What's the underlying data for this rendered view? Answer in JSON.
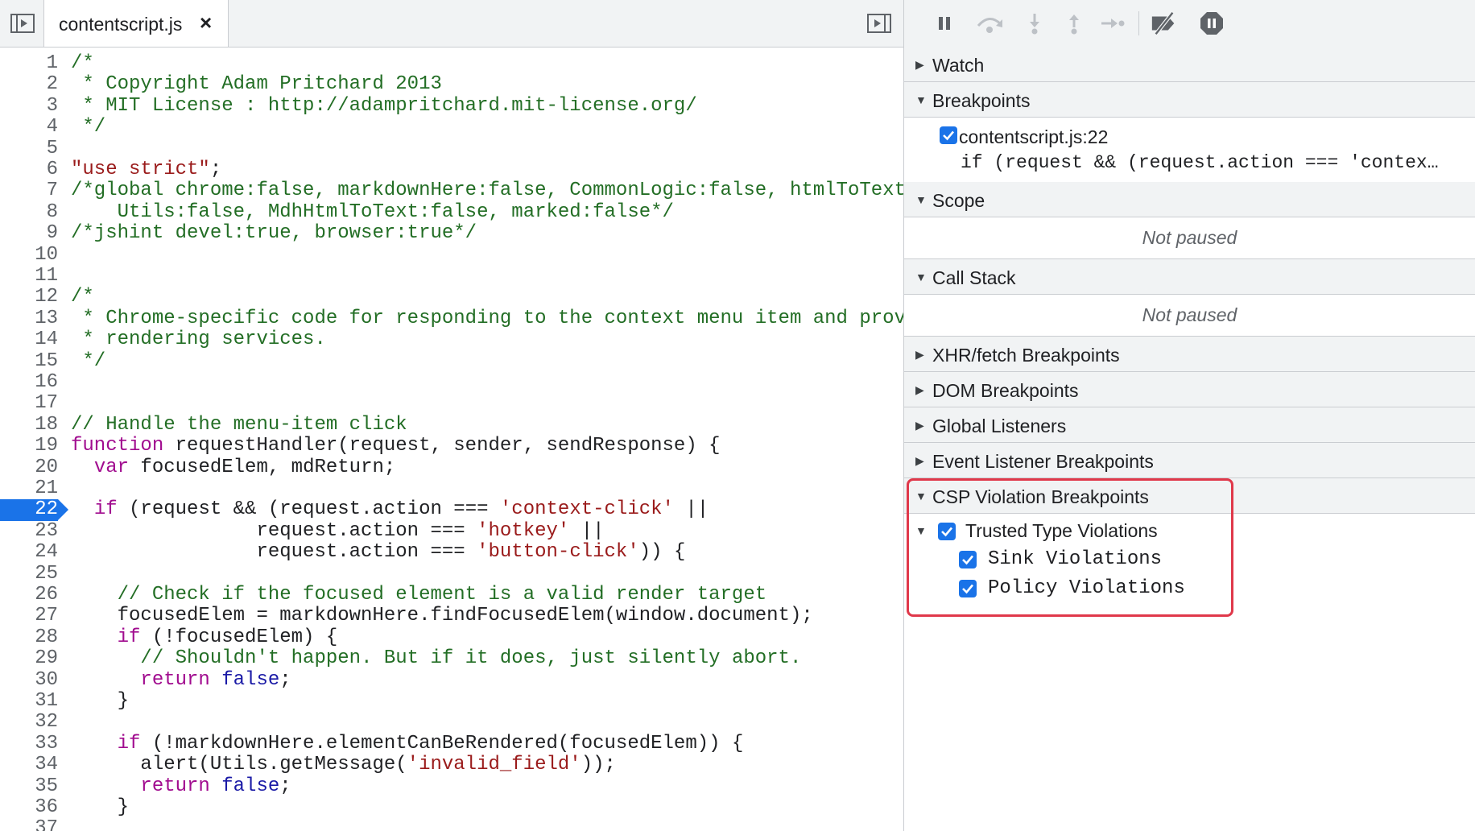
{
  "editor": {
    "tab_label": "contentscript.js",
    "tab_close": "×",
    "breakpoint_line": 22,
    "lines": [
      [
        [
          "c",
          "/*"
        ]
      ],
      [
        [
          "c",
          " * Copyright Adam Pritchard 2013"
        ]
      ],
      [
        [
          "c",
          " * MIT License : http://adampritchard.mit-license.org/"
        ]
      ],
      [
        [
          "c",
          " */"
        ]
      ],
      [],
      [
        [
          "s",
          "\"use strict\""
        ],
        [
          "p",
          ";"
        ]
      ],
      [
        [
          "c",
          "/*global chrome:false, markdownHere:false, CommonLogic:false, htmlToText"
        ]
      ],
      [
        [
          "c",
          "    Utils:false, MdhHtmlToText:false, marked:false*/"
        ]
      ],
      [
        [
          "c",
          "/*jshint devel:true, browser:true*/"
        ]
      ],
      [],
      [],
      [
        [
          "c",
          "/*"
        ]
      ],
      [
        [
          "c",
          " * Chrome-specific code for responding to the context menu item and prov"
        ]
      ],
      [
        [
          "c",
          " * rendering services."
        ]
      ],
      [
        [
          "c",
          " */"
        ]
      ],
      [],
      [],
      [
        [
          "c",
          "// Handle the menu-item click"
        ]
      ],
      [
        [
          "k",
          "function"
        ],
        [
          "p",
          " requestHandler(request, sender, sendResponse) {"
        ]
      ],
      [
        [
          "p",
          "  "
        ],
        [
          "k",
          "var"
        ],
        [
          "p",
          " focusedElem, mdReturn;"
        ]
      ],
      [],
      [
        [
          "p",
          "  "
        ],
        [
          "k",
          "if"
        ],
        [
          "p",
          " (request && (request.action === "
        ],
        [
          "s",
          "'context-click'"
        ],
        [
          "p",
          " ||"
        ]
      ],
      [
        [
          "p",
          "                request.action === "
        ],
        [
          "s",
          "'hotkey'"
        ],
        [
          "p",
          " ||"
        ]
      ],
      [
        [
          "p",
          "                request.action === "
        ],
        [
          "s",
          "'button-click'"
        ],
        [
          "p",
          ")) {"
        ]
      ],
      [],
      [
        [
          "p",
          "    "
        ],
        [
          "c",
          "// Check if the focused element is a valid render target"
        ]
      ],
      [
        [
          "p",
          "    focusedElem = markdownHere.findFocusedElem(window.document);"
        ]
      ],
      [
        [
          "p",
          "    "
        ],
        [
          "k",
          "if"
        ],
        [
          "p",
          " (!focusedElem) {"
        ]
      ],
      [
        [
          "p",
          "      "
        ],
        [
          "c",
          "// Shouldn't happen. But if it does, just silently abort."
        ]
      ],
      [
        [
          "p",
          "      "
        ],
        [
          "k",
          "return"
        ],
        [
          "p",
          " "
        ],
        [
          "b",
          "false"
        ],
        [
          "p",
          ";"
        ]
      ],
      [
        [
          "p",
          "    }"
        ]
      ],
      [],
      [
        [
          "p",
          "    "
        ],
        [
          "k",
          "if"
        ],
        [
          "p",
          " (!markdownHere.elementCanBeRendered(focusedElem)) {"
        ]
      ],
      [
        [
          "p",
          "      alert(Utils.getMessage("
        ],
        [
          "s",
          "'invalid_field'"
        ],
        [
          "p",
          "));"
        ]
      ],
      [
        [
          "p",
          "      "
        ],
        [
          "k",
          "return"
        ],
        [
          "p",
          " "
        ],
        [
          "b",
          "false"
        ],
        [
          "p",
          ";"
        ]
      ],
      [
        [
          "p",
          "    }"
        ]
      ],
      []
    ]
  },
  "sidebar": {
    "sections": {
      "watch": "Watch",
      "breakpoints": "Breakpoints",
      "scope": "Scope",
      "call_stack": "Call Stack",
      "xhr": "XHR/fetch Breakpoints",
      "dom": "DOM Breakpoints",
      "global": "Global Listeners",
      "event": "Event Listener Breakpoints",
      "csp": "CSP Violation Breakpoints"
    },
    "breakpoint_item": {
      "file": "contentscript.js:22",
      "code": "if (request && (request.action === 'contex…",
      "checked": true
    },
    "scope_message": "Not paused",
    "callstack_message": "Not paused",
    "csp": {
      "trusted_types": "Trusted Type Violations",
      "sink": "Sink Violations",
      "policy": "Policy Violations"
    }
  },
  "colors": {
    "accent": "#1a73e8",
    "highlight_border": "#e0384a",
    "comment": "#236e25",
    "string": "#9a1b1b",
    "keyword": "#a10c8f"
  },
  "icons": [
    "sidebar-toggle-icon",
    "close-icon",
    "panel-toggle-icon",
    "pause-icon",
    "step-over-icon",
    "step-into-icon",
    "step-out-icon",
    "step-icon",
    "deactivate-breakpoints-icon",
    "pause-on-exceptions-icon",
    "checkbox-checked-icon"
  ]
}
